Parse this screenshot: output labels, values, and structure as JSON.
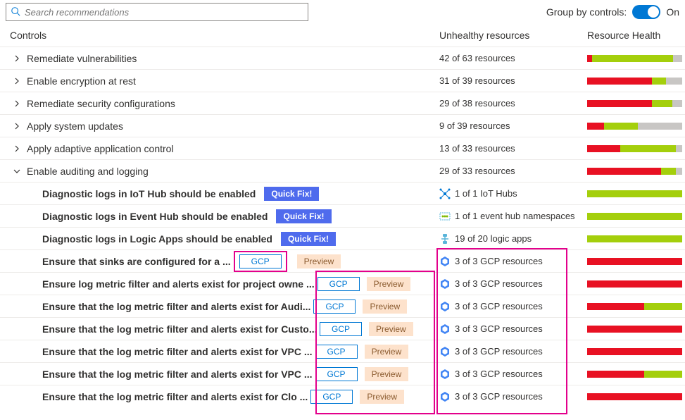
{
  "search": {
    "placeholder": "Search recommendations"
  },
  "groupby": {
    "label": "Group by controls:",
    "state": "On"
  },
  "headers": {
    "controls": "Controls",
    "unhealthy": "Unhealthy resources",
    "health": "Resource Health"
  },
  "controls": [
    {
      "label": "Remediate vulnerabilities",
      "unhealthy": "42 of 63 resources",
      "bar": [
        5,
        85,
        10
      ]
    },
    {
      "label": "Enable encryption at rest",
      "unhealthy": "31 of 39 resources",
      "bar": [
        68,
        15,
        17
      ]
    },
    {
      "label": "Remediate security configurations",
      "unhealthy": "29 of 38 resources",
      "bar": [
        68,
        22,
        10
      ]
    },
    {
      "label": "Apply system updates",
      "unhealthy": "9 of 39 resources",
      "bar": [
        18,
        35,
        47
      ]
    },
    {
      "label": "Apply adaptive application control",
      "unhealthy": "13 of 33 resources",
      "bar": [
        35,
        58,
        7
      ]
    },
    {
      "label": "Enable auditing and logging",
      "unhealthy": "29 of 33 resources",
      "bar": [
        78,
        15,
        7
      ]
    }
  ],
  "children": [
    {
      "label": "Diagnostic logs in IoT Hub should be enabled",
      "badge": "quickfix",
      "icon": "iot",
      "res": "1 of 1 IoT Hubs",
      "bar": [
        0,
        100,
        0
      ]
    },
    {
      "label": "Diagnostic logs in Event Hub should be enabled",
      "badge": "quickfix",
      "icon": "eventhub",
      "res": "1 of 1 event hub namespaces",
      "bar": [
        0,
        100,
        0
      ]
    },
    {
      "label": "Diagnostic logs in Logic Apps should be enabled",
      "badge": "quickfix",
      "icon": "logicapp",
      "res": "19 of 20 logic apps",
      "bar": [
        0,
        100,
        0
      ]
    },
    {
      "label": "Ensure that sinks are configured for a ...",
      "badge": "gcp",
      "icon": "gcp",
      "res": "3 of 3 GCP resources",
      "bar": [
        100,
        0,
        0
      ],
      "sp": true
    },
    {
      "label": "Ensure log metric filter and alerts exist for project owne ...",
      "badge": "gcp",
      "icon": "gcp",
      "res": "3 of 3 GCP resources",
      "bar": [
        100,
        0,
        0
      ]
    },
    {
      "label": "Ensure that the log metric filter and alerts exist for Audi...",
      "badge": "gcp",
      "icon": "gcp",
      "res": "3 of 3 GCP resources",
      "bar": [
        60,
        40,
        0
      ]
    },
    {
      "label": "Ensure that the log metric filter and alerts exist for Custo...",
      "badge": "gcp",
      "icon": "gcp",
      "res": "3 of 3 GCP resources",
      "bar": [
        100,
        0,
        0
      ]
    },
    {
      "label": "Ensure that the log metric filter and alerts exist for VPC ...",
      "badge": "gcp",
      "icon": "gcp",
      "res": "3 of 3 GCP resources",
      "bar": [
        100,
        0,
        0
      ]
    },
    {
      "label": "Ensure that the log metric filter and alerts exist for VPC ...",
      "badge": "gcp",
      "icon": "gcp",
      "res": "3 of 3 GCP resources",
      "bar": [
        60,
        40,
        0
      ]
    },
    {
      "label": "Ensure that the log metric filter and alerts exist for Clo ...",
      "badge": "gcp",
      "icon": "gcp",
      "res": "3 of 3 GCP resources",
      "bar": [
        100,
        0,
        0
      ]
    }
  ],
  "badges": {
    "quickfix": "Quick Fix!",
    "gcp": "GCP",
    "preview": "Preview"
  }
}
